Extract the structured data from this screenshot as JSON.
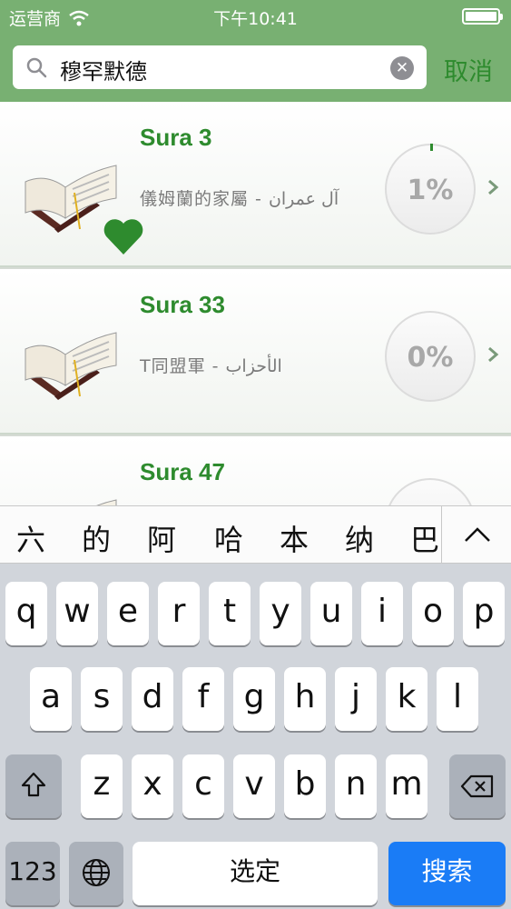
{
  "status_bar": {
    "carrier": "运营商",
    "time": "下午10:41"
  },
  "search": {
    "query": "穆罕默德",
    "cancel_label": "取消"
  },
  "suras": [
    {
      "title": "Sura 3",
      "subtitle": "儀姆蘭的家屬 - آل عمران",
      "progress": "1%",
      "favorite": true
    },
    {
      "title": "Sura 33",
      "subtitle": "T同盟軍 - الأحزاب",
      "progress": "0%",
      "favorite": false
    },
    {
      "title": "Sura 47",
      "subtitle": "",
      "progress": "",
      "favorite": false
    }
  ],
  "candidates": [
    "六",
    "的",
    "阿",
    "哈",
    "本",
    "纳",
    "巴"
  ],
  "keyboard": {
    "row1": [
      "q",
      "w",
      "e",
      "r",
      "t",
      "y",
      "u",
      "i",
      "o",
      "p"
    ],
    "row2": [
      "a",
      "s",
      "d",
      "f",
      "g",
      "h",
      "j",
      "k",
      "l"
    ],
    "row3": [
      "z",
      "x",
      "c",
      "v",
      "b",
      "n",
      "m"
    ],
    "numbers_key": "123",
    "space_key": "选定",
    "return_key": "搜索"
  },
  "colors": {
    "header_green": "#78b072",
    "accent_green": "#2e8b2e",
    "return_blue": "#1a7cf6"
  }
}
